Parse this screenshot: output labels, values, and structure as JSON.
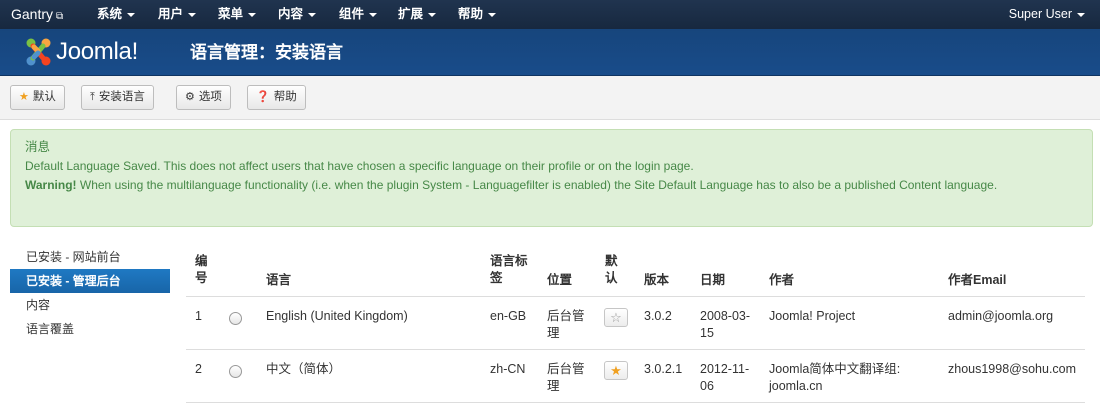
{
  "topnav": {
    "brand": "Gantry",
    "menus": [
      "系统",
      "用户",
      "菜单",
      "内容",
      "组件",
      "扩展",
      "帮助"
    ],
    "user": "Super User"
  },
  "header": {
    "logo_text": "Joomla!",
    "title": "语言管理：安装语言"
  },
  "toolbar": {
    "default_label": "默认",
    "install_label": "安装语言",
    "options_label": "选项",
    "help_label": "帮助"
  },
  "message": {
    "heading": "消息",
    "line1": "Default Language Saved. This does not affect users that have chosen a specific language on their profile or on the login page.",
    "warning_label": "Warning!",
    "warning_text": " When using the multilanguage functionality (i.e. when the plugin System - Languagefilter is enabled) the Site Default Language has to also be a published Content language."
  },
  "sidebar": {
    "items": [
      "已安装 - 网站前台",
      "已安装 - 管理后台",
      "内容",
      "语言覆盖"
    ]
  },
  "table": {
    "headers": {
      "num_1": "编",
      "num_2": "号",
      "language": "语言",
      "tag_1": "语言标",
      "tag_2": "签",
      "location": "位置",
      "default_1": "默",
      "default_2": "认",
      "version": "版本",
      "date": "日期",
      "author": "作者",
      "email": "作者Email"
    },
    "rows": [
      {
        "num": "1",
        "language": "English (United Kingdom)",
        "tag": "en-GB",
        "location_1": "后台管",
        "location_2": "理",
        "is_default": false,
        "version": "3.0.2",
        "date_1": "2008-03-",
        "date_2": "15",
        "author_1": "Joomla! Project",
        "author_2": "",
        "email": "admin@joomla.org"
      },
      {
        "num": "2",
        "language": "中文（简体）",
        "tag": "zh-CN",
        "location_1": "后台管",
        "location_2": "理",
        "is_default": true,
        "version": "3.0.2.1",
        "date_1": "2012-11-",
        "date_2": "06",
        "author_1": "Joomla简体中文翻译组:",
        "author_2": "joomla.cn",
        "email": "zhous1998@sohu.com"
      }
    ]
  }
}
